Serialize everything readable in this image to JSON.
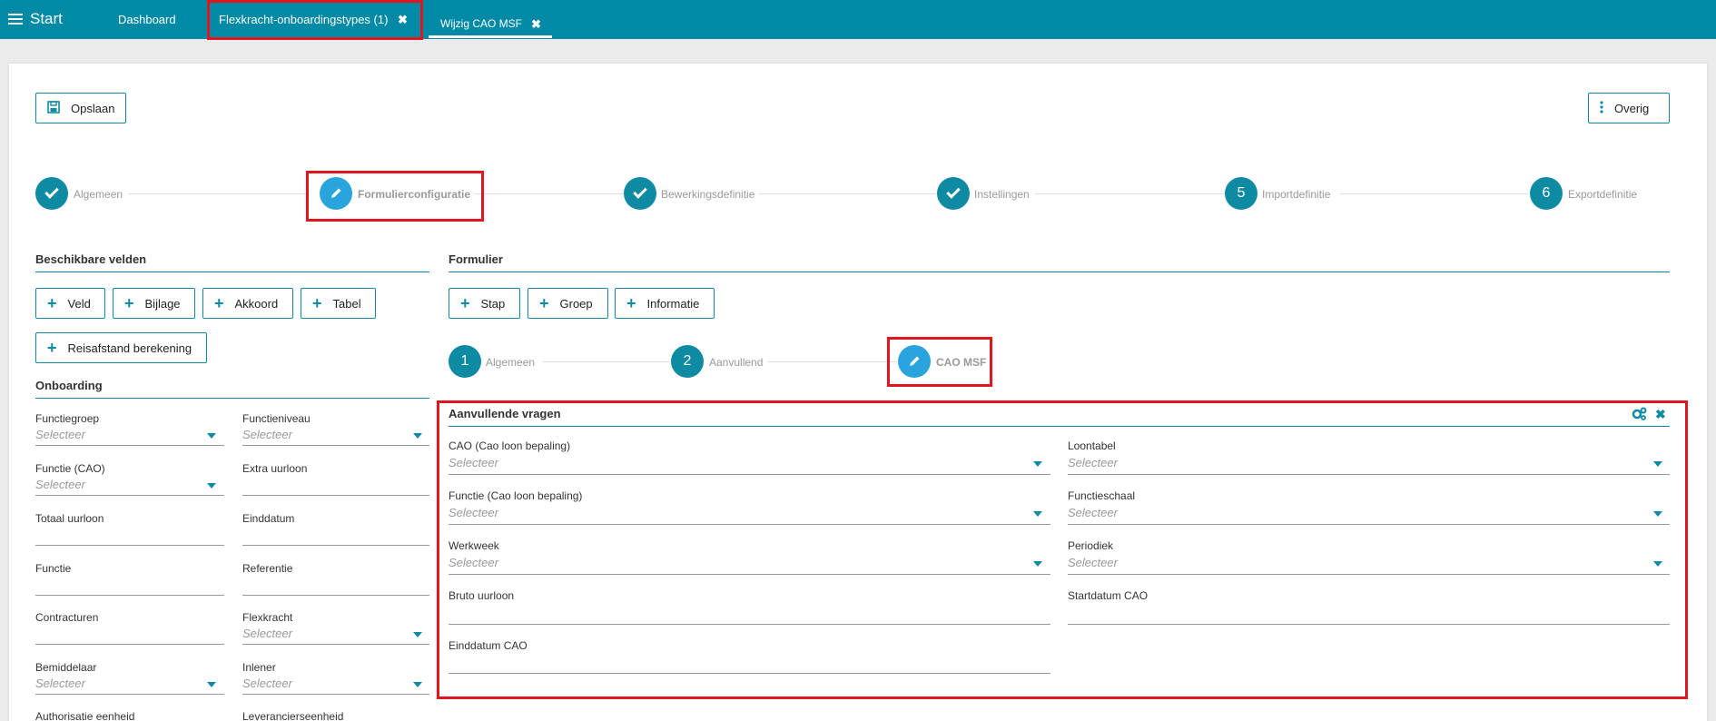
{
  "topbar": {
    "start": "Start",
    "dashboard": "Dashboard",
    "tab_onboardingtypes": "Flexkracht-onboardingstypes (1)",
    "tab_wijzig": "Wijzig CAO MSF",
    "close_glyph": "✖"
  },
  "toolbar": {
    "save": "Opslaan",
    "more": "Overig"
  },
  "wizard": [
    {
      "label": "Algemeen",
      "state": "done"
    },
    {
      "label": "Formulierconfiguratie",
      "state": "active"
    },
    {
      "label": "Bewerkingsdefinitie",
      "state": "done"
    },
    {
      "label": "Instellingen",
      "state": "done"
    },
    {
      "label": "Importdefinitie",
      "number": "5"
    },
    {
      "label": "Exportdefinitie",
      "number": "6"
    }
  ],
  "left": {
    "title": "Beschikbare velden",
    "buttons": [
      "Veld",
      "Bijlage",
      "Akkoord",
      "Tabel",
      "Reisafstand berekening"
    ],
    "onboarding_title": "Onboarding",
    "fields": [
      {
        "label": "Functiegroep",
        "placeholder": "Selecteer"
      },
      {
        "label": "Functieniveau",
        "placeholder": "Selecteer"
      },
      {
        "label": "Functie (CAO)",
        "placeholder": "Selecteer"
      },
      {
        "label": "Extra uurloon",
        "placeholder": ""
      },
      {
        "label": "Totaal uurloon",
        "placeholder": ""
      },
      {
        "label": "Einddatum",
        "placeholder": ""
      },
      {
        "label": "Functie",
        "placeholder": ""
      },
      {
        "label": "Referentie",
        "placeholder": ""
      },
      {
        "label": "Contracturen",
        "placeholder": ""
      },
      {
        "label": "Flexkracht",
        "placeholder": "Selecteer"
      },
      {
        "label": "Bemiddelaar",
        "placeholder": "Selecteer"
      },
      {
        "label": "Inlener",
        "placeholder": "Selecteer"
      },
      {
        "label": "Authorisatie eenheid",
        "placeholder": ""
      },
      {
        "label": "Leverancierseenheid",
        "placeholder": ""
      }
    ]
  },
  "form": {
    "title": "Formulier",
    "buttons": [
      "Stap",
      "Groep",
      "Informatie"
    ],
    "steps": [
      {
        "number": "1",
        "label": "Algemeen"
      },
      {
        "number": "2",
        "label": "Aanvullend"
      },
      {
        "label": "CAO MSF",
        "state": "active"
      }
    ],
    "group_title": "Aanvullende vragen",
    "group_fields": [
      {
        "label": "CAO (Cao loon bepaling)",
        "placeholder": "Selecteer"
      },
      {
        "label": "Loontabel",
        "placeholder": "Selecteer"
      },
      {
        "label": "Functie (Cao loon bepaling)",
        "placeholder": "Selecteer"
      },
      {
        "label": "Functieschaal",
        "placeholder": "Selecteer"
      },
      {
        "label": "Werkweek",
        "placeholder": "Selecteer"
      },
      {
        "label": "Periodiek",
        "placeholder": "Selecteer"
      },
      {
        "label": "Bruto uurloon",
        "placeholder": ""
      },
      {
        "label": "Startdatum CAO",
        "placeholder": ""
      },
      {
        "label": "Einddatum CAO",
        "placeholder": ""
      }
    ]
  },
  "colors": {
    "topbar": "#008aa6",
    "accent": "#0e8aa3",
    "active_step": "#29a4dd",
    "highlight": "#e0161f"
  }
}
